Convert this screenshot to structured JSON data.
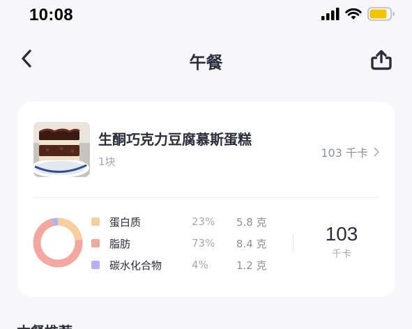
{
  "status_bar": {
    "time": "10:08"
  },
  "nav": {
    "title": "午餐"
  },
  "food": {
    "name": "生酮巧克力豆腐慕斯蛋糕",
    "quantity": "1块",
    "calories": "103 千卡"
  },
  "nutrition": {
    "items": [
      {
        "name": "蛋白质",
        "percent": "23%",
        "amount": "5.8 克",
        "color": "#f7cf9e",
        "ratio": 0.23
      },
      {
        "name": "脂肪",
        "percent": "73%",
        "amount": "8.4 克",
        "color": "#f2a79f",
        "ratio": 0.73
      },
      {
        "name": "碳水化合物",
        "percent": "4%",
        "amount": "1.2 克",
        "color": "#b3b2f2",
        "ratio": 0.04
      }
    ],
    "total_value": "103",
    "total_unit": "千卡"
  },
  "next_section_title": "本餐推荐",
  "icons": {
    "back": "chevron-left-icon",
    "share": "share-upload-icon",
    "signal": "cellular-signal-icon",
    "wifi": "wifi-icon",
    "battery": "battery-icon",
    "chevron": "chevron-right-icon"
  }
}
